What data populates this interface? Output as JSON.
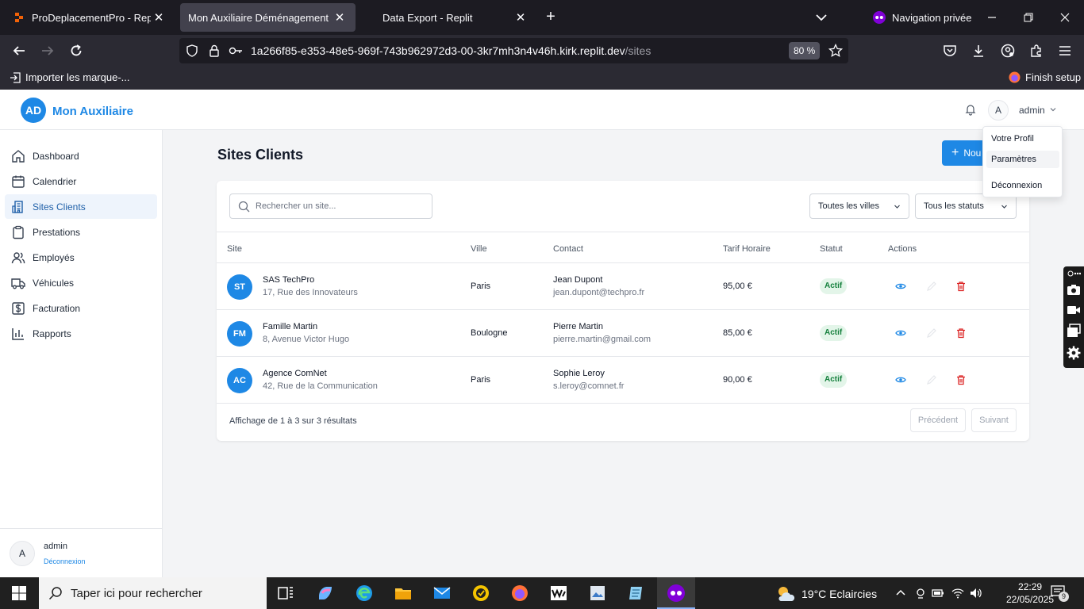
{
  "browser": {
    "tabs": [
      {
        "title": "ProDeplacementPro - Replit",
        "active": false
      },
      {
        "title": "Mon Auxiliaire Déménagement",
        "active": true
      },
      {
        "title": "Data Export - Replit",
        "active": false
      }
    ],
    "private_label": "Navigation privée",
    "url_host": "1a266f85-e353-48e5-969f-743b962972d3-00-3kr7mh3n4v46h.kirk.replit.dev",
    "url_path": "/sites",
    "zoom": "80 %",
    "bookmarks": {
      "import_label": "Importer les marque-...",
      "finish_setup": "Finish setup"
    }
  },
  "app": {
    "logo_initials": "AD",
    "logo_text": "Mon Auxiliaire",
    "user": {
      "initial": "A",
      "name": "admin"
    },
    "user_menu": [
      "Votre Profil",
      "Paramètres",
      "Déconnexion"
    ],
    "sidebar": {
      "items": [
        {
          "label": "Dashboard",
          "icon": "home-icon"
        },
        {
          "label": "Calendrier",
          "icon": "calendar-icon"
        },
        {
          "label": "Sites Clients",
          "icon": "building-icon"
        },
        {
          "label": "Prestations",
          "icon": "clipboard-icon"
        },
        {
          "label": "Employés",
          "icon": "users-icon"
        },
        {
          "label": "Véhicules",
          "icon": "truck-icon"
        },
        {
          "label": "Facturation",
          "icon": "dollar-icon"
        },
        {
          "label": "Rapports",
          "icon": "bar-chart-icon"
        }
      ],
      "active_index": 2,
      "footer_name": "admin",
      "footer_logout": "Déconnexion"
    },
    "page_title": "Sites Clients",
    "new_button_label": "Nou",
    "search_placeholder": "Rechercher un site...",
    "filter_city": "Toutes les villes",
    "filter_status": "Tous les statuts",
    "table": {
      "columns": [
        "Site",
        "Ville",
        "Contact",
        "Tarif Horaire",
        "Statut",
        "Actions"
      ],
      "rows": [
        {
          "initials": "ST",
          "name": "SAS TechPro",
          "address": "17, Rue des Innovateurs",
          "city": "Paris",
          "contact_name": "Jean Dupont",
          "contact_email": "jean.dupont@techpro.fr",
          "rate": "95,00 €",
          "status": "Actif"
        },
        {
          "initials": "FM",
          "name": "Famille Martin",
          "address": "8, Avenue Victor Hugo",
          "city": "Boulogne",
          "contact_name": "Pierre Martin",
          "contact_email": "pierre.martin@gmail.com",
          "rate": "85,00 €",
          "status": "Actif"
        },
        {
          "initials": "AC",
          "name": "Agence ComNet",
          "address": "42, Rue de la Communication",
          "city": "Paris",
          "contact_name": "Sophie Leroy",
          "contact_email": "s.leroy@comnet.fr",
          "rate": "90,00 €",
          "status": "Actif"
        }
      ]
    },
    "result_info": "Affichage de 1 à 3 sur 3 résultats",
    "pagination": {
      "prev": "Précédent",
      "next": "Suivant"
    }
  },
  "taskbar": {
    "search_placeholder": "Taper ici pour rechercher",
    "weather": "19°C  Eclaircies",
    "time": "22:29",
    "date": "22/05/2025",
    "notification_count": "9"
  },
  "colors": {
    "accent": "#1e88e5",
    "active_badge_bg": "#e3f5e9",
    "active_badge_text": "#15803d",
    "delete": "#dc2626"
  }
}
